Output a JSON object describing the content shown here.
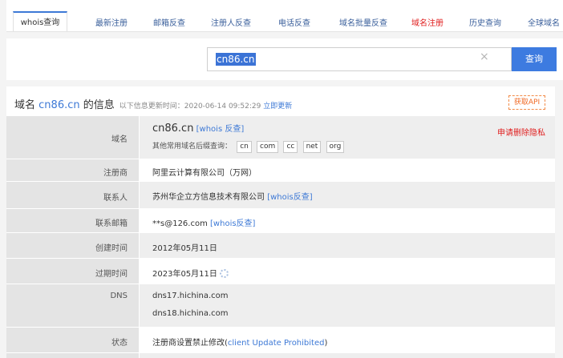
{
  "tabs": [
    {
      "label": "whois查询"
    },
    {
      "label": "最新注册"
    },
    {
      "label": "邮箱反查"
    },
    {
      "label": "注册人反查"
    },
    {
      "label": "电话反查"
    },
    {
      "label": "域名批量反查"
    },
    {
      "label": "域名注册"
    },
    {
      "label": "历史查询"
    },
    {
      "label": "全球域名"
    }
  ],
  "search": {
    "value": "cn86.cn",
    "button": "查询",
    "clear": "×"
  },
  "header": {
    "title_prefix": "域名",
    "domain": "cn86.cn",
    "title_suffix": "的信息",
    "updated_label": "以下信息更新时间：",
    "updated_time": "2020-06-14 09:52:29",
    "update_now": "立即更新",
    "api_button": "获取API"
  },
  "rows": {
    "domain": {
      "label": "域名",
      "value": "cn86.cn",
      "whois_link": "[whois 反查]",
      "privacy": "申请删除隐私",
      "suffix_label": "其他常用域名后缀查询：",
      "suffixes": [
        "cn",
        "com",
        "cc",
        "net",
        "org"
      ]
    },
    "registrar": {
      "label": "注册商",
      "value": "阿里云计算有限公司（万网）"
    },
    "registrant": {
      "label": "联系人",
      "value": "苏州华企立方信息技术有限公司",
      "link": "[whois反查]"
    },
    "email": {
      "label": "联系邮箱",
      "value": "**s@126.com",
      "link": "[whois反查]"
    },
    "created": {
      "label": "创建时间",
      "value": "2012年05月11日"
    },
    "expires": {
      "label": "过期时间",
      "value": "2023年05月11日"
    },
    "dns": {
      "label": "DNS",
      "values": [
        "dns17.hichina.com",
        "dns18.hichina.com"
      ]
    },
    "status": {
      "label": "状态",
      "value_prefix": "注册商设置禁止修改(",
      "value_code": "client Update Prohibited",
      "value_suffix": ")"
    }
  },
  "colors": {
    "accent": "#3d79d6",
    "danger": "#e02020",
    "api": "#f06a25"
  }
}
